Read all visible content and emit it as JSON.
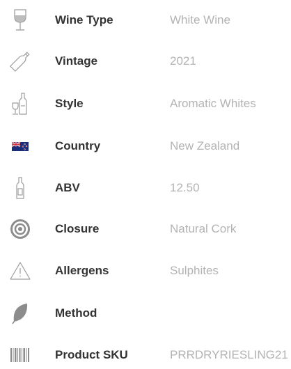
{
  "colors": {
    "label": "#333333",
    "value": "#b3b3b3",
    "icon_stroke": "#9e9e9e",
    "leaf_fill": "#8c8c8c"
  },
  "specs": [
    {
      "icon": "wine-glass-icon",
      "label": "Wine Type",
      "value": "White Wine"
    },
    {
      "icon": "wine-bottle-icon",
      "label": "Vintage",
      "value": "2021"
    },
    {
      "icon": "glass-and-bottle-icon",
      "label": "Style",
      "value": "Aromatic Whites"
    },
    {
      "icon": "new-zealand-flag-icon",
      "label": "Country",
      "value": "New Zealand"
    },
    {
      "icon": "bottle-icon",
      "label": "ABV",
      "value": "12.50"
    },
    {
      "icon": "cork-target-icon",
      "label": "Closure",
      "value": "Natural Cork"
    },
    {
      "icon": "warning-triangle-icon",
      "label": "Allergens",
      "value": "Sulphites"
    },
    {
      "icon": "leaf-icon",
      "label": "Method",
      "value": ""
    },
    {
      "icon": "barcode-icon",
      "label": "Product SKU",
      "value": "PRRDRYRIESLING21"
    }
  ]
}
